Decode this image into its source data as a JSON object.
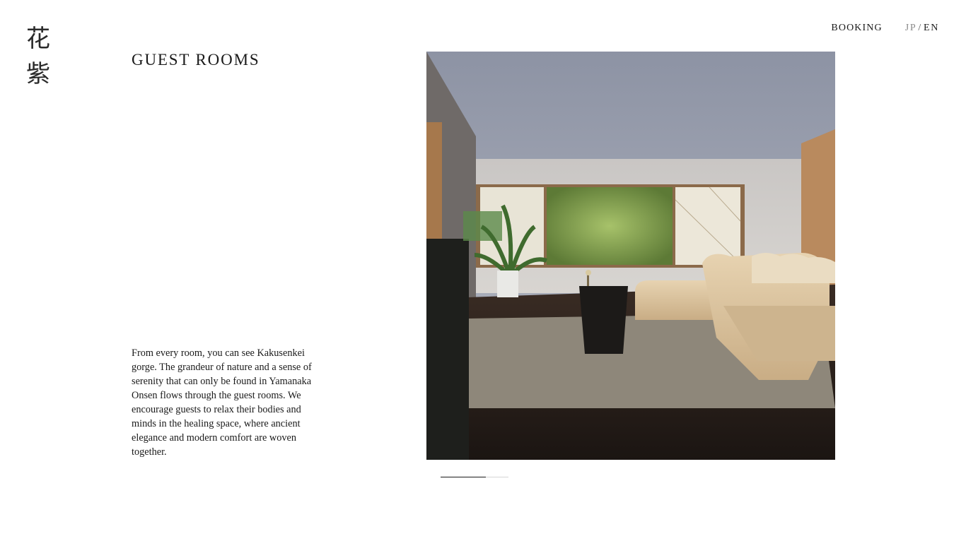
{
  "logo": {
    "char1": "花",
    "char2": "紫"
  },
  "nav": {
    "booking": "BOOKING",
    "lang_jp": "JP",
    "lang_sep": "/",
    "lang_en": "EN"
  },
  "section": {
    "title": "GUEST ROOMS",
    "description": "From every room, you can see Kakusenkei gorge. The grandeur of nature and a sense of serenity that can only be found in Yamanaka Onsen flows through the guest rooms. We encourage guests to relax their bodies and minds in the healing space, where ancient elegance and modern comfort are woven together."
  },
  "slider": {
    "progress": 0.67
  },
  "colors": {
    "text": "#1a1a1a",
    "muted": "#8a8a8a",
    "track": "#d6d6d6"
  }
}
